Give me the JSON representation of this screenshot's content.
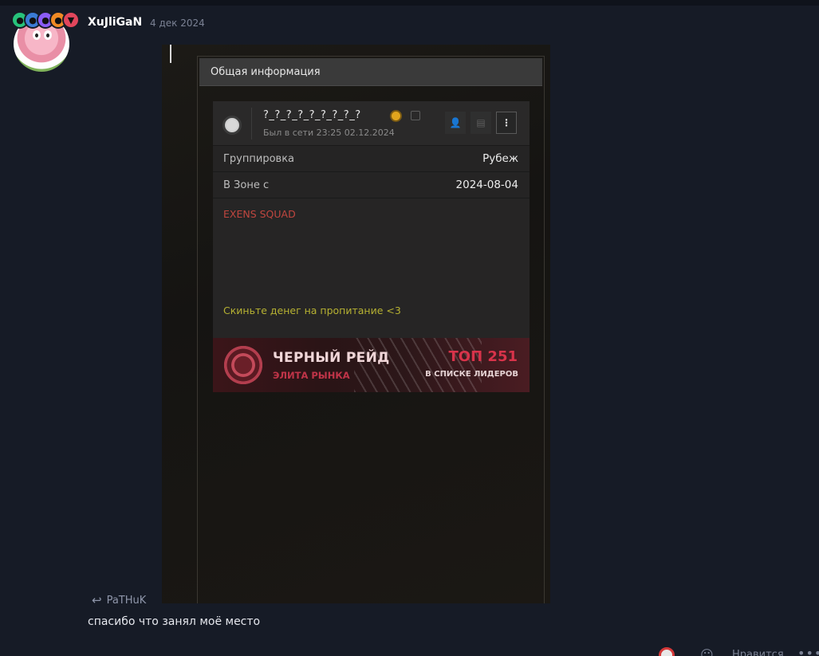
{
  "post": {
    "username": "XuJliGaN",
    "date": "4 дек 2024",
    "badges": [
      {
        "icon": "badge-green",
        "color": "#27c27b"
      },
      {
        "icon": "badge-blue",
        "color": "#3a7bd5"
      },
      {
        "icon": "badge-purple",
        "color": "#8b5cf6"
      },
      {
        "icon": "badge-orange",
        "color": "#f08a24"
      },
      {
        "icon": "badge-red",
        "color": "#e2465c"
      }
    ]
  },
  "screenshot": {
    "panel_title": "Общая информация",
    "player": {
      "nickname": "?_?_?_?_?_?_?_?_?",
      "last_seen": "Был в сети 23:25 02.12.2024"
    },
    "rows": [
      {
        "key": "Группировка",
        "value": "Рубеж"
      },
      {
        "key": "В Зоне с",
        "value": "2024-08-04"
      }
    ],
    "bio": {
      "squad": "EXENS SQUAD",
      "message": "Скиньте денег на пропитание <3"
    },
    "raid": {
      "title": "ЧЕРНЫЙ РЕЙД",
      "subtitle": "ЭЛИТА РЫНКА",
      "rank": "ТОП 251",
      "rank_label": "В СПИСКЕ ЛИДЕРОВ"
    }
  },
  "reply": {
    "reference_user": "PaTHuK",
    "text": "спасибо что занял моё место"
  },
  "footer": {
    "like_label": "Нравится"
  },
  "colors": {
    "background": "#161b26",
    "squad": "#c0463f",
    "donate": "#b6b132",
    "raid_accent": "#d8334a"
  }
}
